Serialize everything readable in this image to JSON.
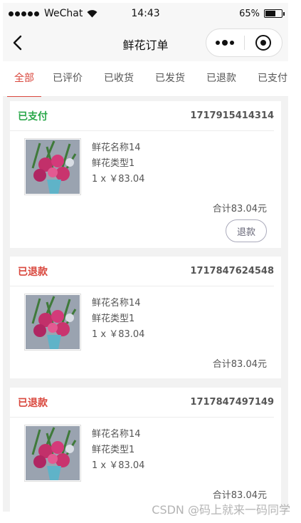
{
  "status_bar": {
    "carrier": "WeChat",
    "time": "14:43",
    "battery": "65%",
    "battery_level": 0.65
  },
  "navbar": {
    "title": "鲜花订单"
  },
  "tabs": [
    {
      "label": "全部"
    },
    {
      "label": "已评价"
    },
    {
      "label": "已收货"
    },
    {
      "label": "已发货"
    },
    {
      "label": "已退款"
    },
    {
      "label": "已支付"
    }
  ],
  "active_tab": "全部",
  "colors": {
    "accent": "#d9473d",
    "paid": "#2aa84a",
    "refunded": "#d9473d"
  },
  "orders": [
    {
      "status": "已支付",
      "order_no": "1717915414314",
      "name": "鲜花名称14",
      "type": "鲜花类型1",
      "qty_price": "1 x ￥83.04",
      "total": "合计83.04元",
      "action": "退款"
    },
    {
      "status": "已退款",
      "order_no": "1717847624548",
      "name": "鲜花名称14",
      "type": "鲜花类型1",
      "qty_price": "1 x ￥83.04",
      "total": "合计83.04元"
    },
    {
      "status": "已退款",
      "order_no": "1717847497149",
      "name": "鲜花名称14",
      "type": "鲜花类型1",
      "qty_price": "1 x ￥83.04",
      "total": "合计83.04元"
    }
  ],
  "watermark": "CSDN @码上就来一码同学"
}
